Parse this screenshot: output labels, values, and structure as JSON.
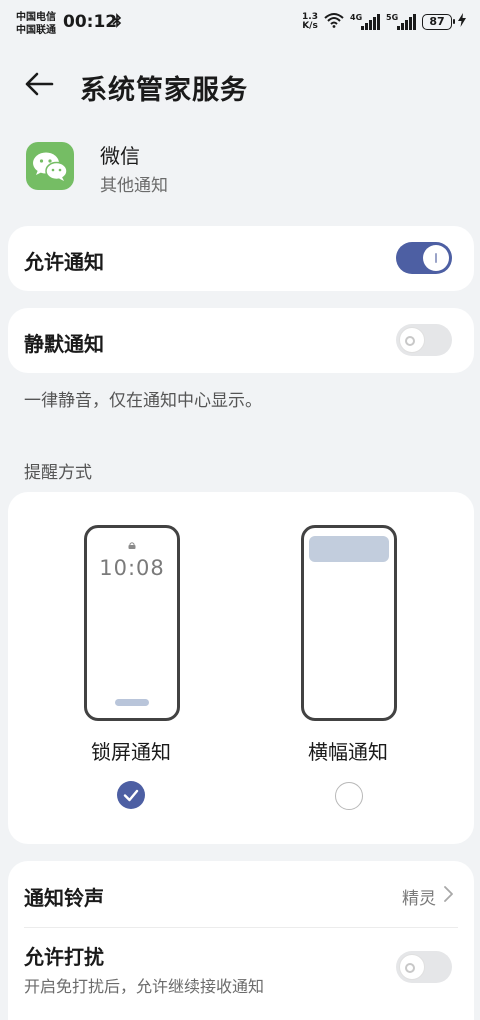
{
  "status_bar": {
    "carrier_1": "中国电信",
    "carrier_2": "中国联通",
    "time": "00:12",
    "net_speed_value": "1.3",
    "net_speed_unit": "K/s",
    "sim1_tag": "4G",
    "sim2_tag": "5G",
    "battery": "87"
  },
  "header": {
    "title": "系统管家服务"
  },
  "app": {
    "name": "微信",
    "subtitle": "其他通知"
  },
  "allow_notifications": {
    "label": "允许通知",
    "enabled": true
  },
  "silent_notifications": {
    "label": "静默通知",
    "enabled": false,
    "hint": "一律静音，仅在通知中心显示。"
  },
  "reminder": {
    "section_title": "提醒方式",
    "lock_screen": {
      "label": "锁屏通知",
      "preview_time": "10:08",
      "selected": true
    },
    "banner": {
      "label": "横幅通知",
      "selected": false
    }
  },
  "ringtone": {
    "label": "通知铃声",
    "value": "精灵"
  },
  "allow_disturb": {
    "label": "允许打扰",
    "subtitle": "开启免打扰后，允许继续接收通知",
    "enabled": false
  },
  "colors": {
    "accent": "#4d5fa3",
    "background": "#f1f3f5",
    "wechat_green": "#75bd64"
  }
}
